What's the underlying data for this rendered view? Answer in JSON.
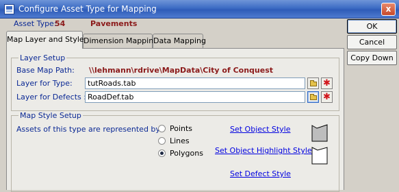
{
  "window": {
    "title": "Configure Asset Type for Mapping",
    "close_glyph": "x"
  },
  "asset_type": {
    "label": "Asset Type:",
    "id": "54",
    "name": "Pavements"
  },
  "side_buttons": {
    "ok": "OK",
    "cancel": "Cancel",
    "copy_down": "Copy Down"
  },
  "tabs": [
    {
      "label": "Map Layer and Style",
      "active": true
    },
    {
      "label": "Dimension Mapping",
      "active": false
    },
    {
      "label": "Data Mapping",
      "active": false
    }
  ],
  "layer_setup": {
    "title": "Layer Setup",
    "base_map_path_label": "Base Map Path:",
    "base_map_path_value": "\\\\lehmann\\rdrive\\MapData\\City of Conquest",
    "type_label": "Layer for Type:",
    "type_value": "tutRoads.tab",
    "defects_label": "Layer for Defects :",
    "defects_value": "RoadDef.tab",
    "icons": {
      "browse": "folder-icon",
      "clear": "red-star-icon"
    }
  },
  "map_style_setup": {
    "title": "Map Style Setup",
    "represented_by_label": "Assets of this type are represented by:",
    "options": [
      {
        "label": "Points",
        "checked": false
      },
      {
        "label": "Lines",
        "checked": false
      },
      {
        "label": "Polygons",
        "checked": true
      }
    ],
    "links": {
      "object_style": "Set Object Style",
      "object_highlight_style": "Set Object Highlight Style",
      "defect_style": "Set Defect Style"
    },
    "preview_fill_color": "#bdbdbd"
  }
}
